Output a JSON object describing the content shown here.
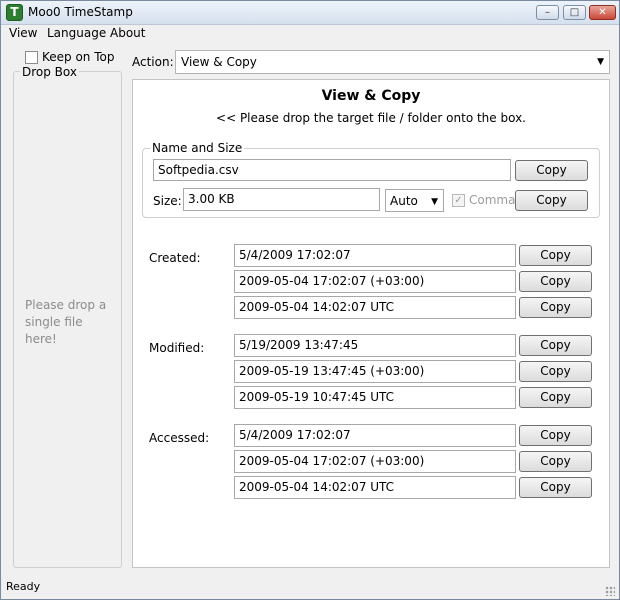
{
  "window": {
    "title": "Moo0 TimeStamp",
    "icon_letter": "T"
  },
  "menu": [
    {
      "label": "View"
    },
    {
      "label": "Language"
    },
    {
      "label": "About"
    }
  ],
  "keep_on_top": {
    "label": "Keep on Top",
    "checked": false
  },
  "drop_box": {
    "legend": "Drop Box",
    "hint": "Please drop a single file here!"
  },
  "action": {
    "label": "Action:",
    "value": "View & Copy"
  },
  "panel": {
    "title": "View & Copy",
    "subtitle": "<< Please drop the target file / folder onto the box."
  },
  "name_size": {
    "legend": "Name and Size",
    "filename": "Softpedia.csv",
    "size_label": "Size:",
    "size_value": "3.00 KB",
    "unit": "Auto",
    "comma_label": "Comma",
    "comma_checked": true,
    "copy_label": "Copy"
  },
  "timestamps": [
    {
      "label": "Created:",
      "values": [
        "5/4/2009 17:02:07",
        "2009-05-04 17:02:07 (+03:00)",
        "2009-05-04 14:02:07 UTC"
      ]
    },
    {
      "label": "Modified:",
      "values": [
        "5/19/2009 13:47:45",
        "2009-05-19 13:47:45 (+03:00)",
        "2009-05-19 10:47:45 UTC"
      ]
    },
    {
      "label": "Accessed:",
      "values": [
        "5/4/2009 17:02:07",
        "2009-05-04 17:02:07 (+03:00)",
        "2009-05-04 14:02:07 UTC"
      ]
    }
  ],
  "copy_label": "Copy",
  "status": "Ready",
  "icons": {
    "minimize": "minimize-icon",
    "maximize": "maximize-icon",
    "close": "close-icon",
    "dropdown": "chevron-down-icon"
  }
}
